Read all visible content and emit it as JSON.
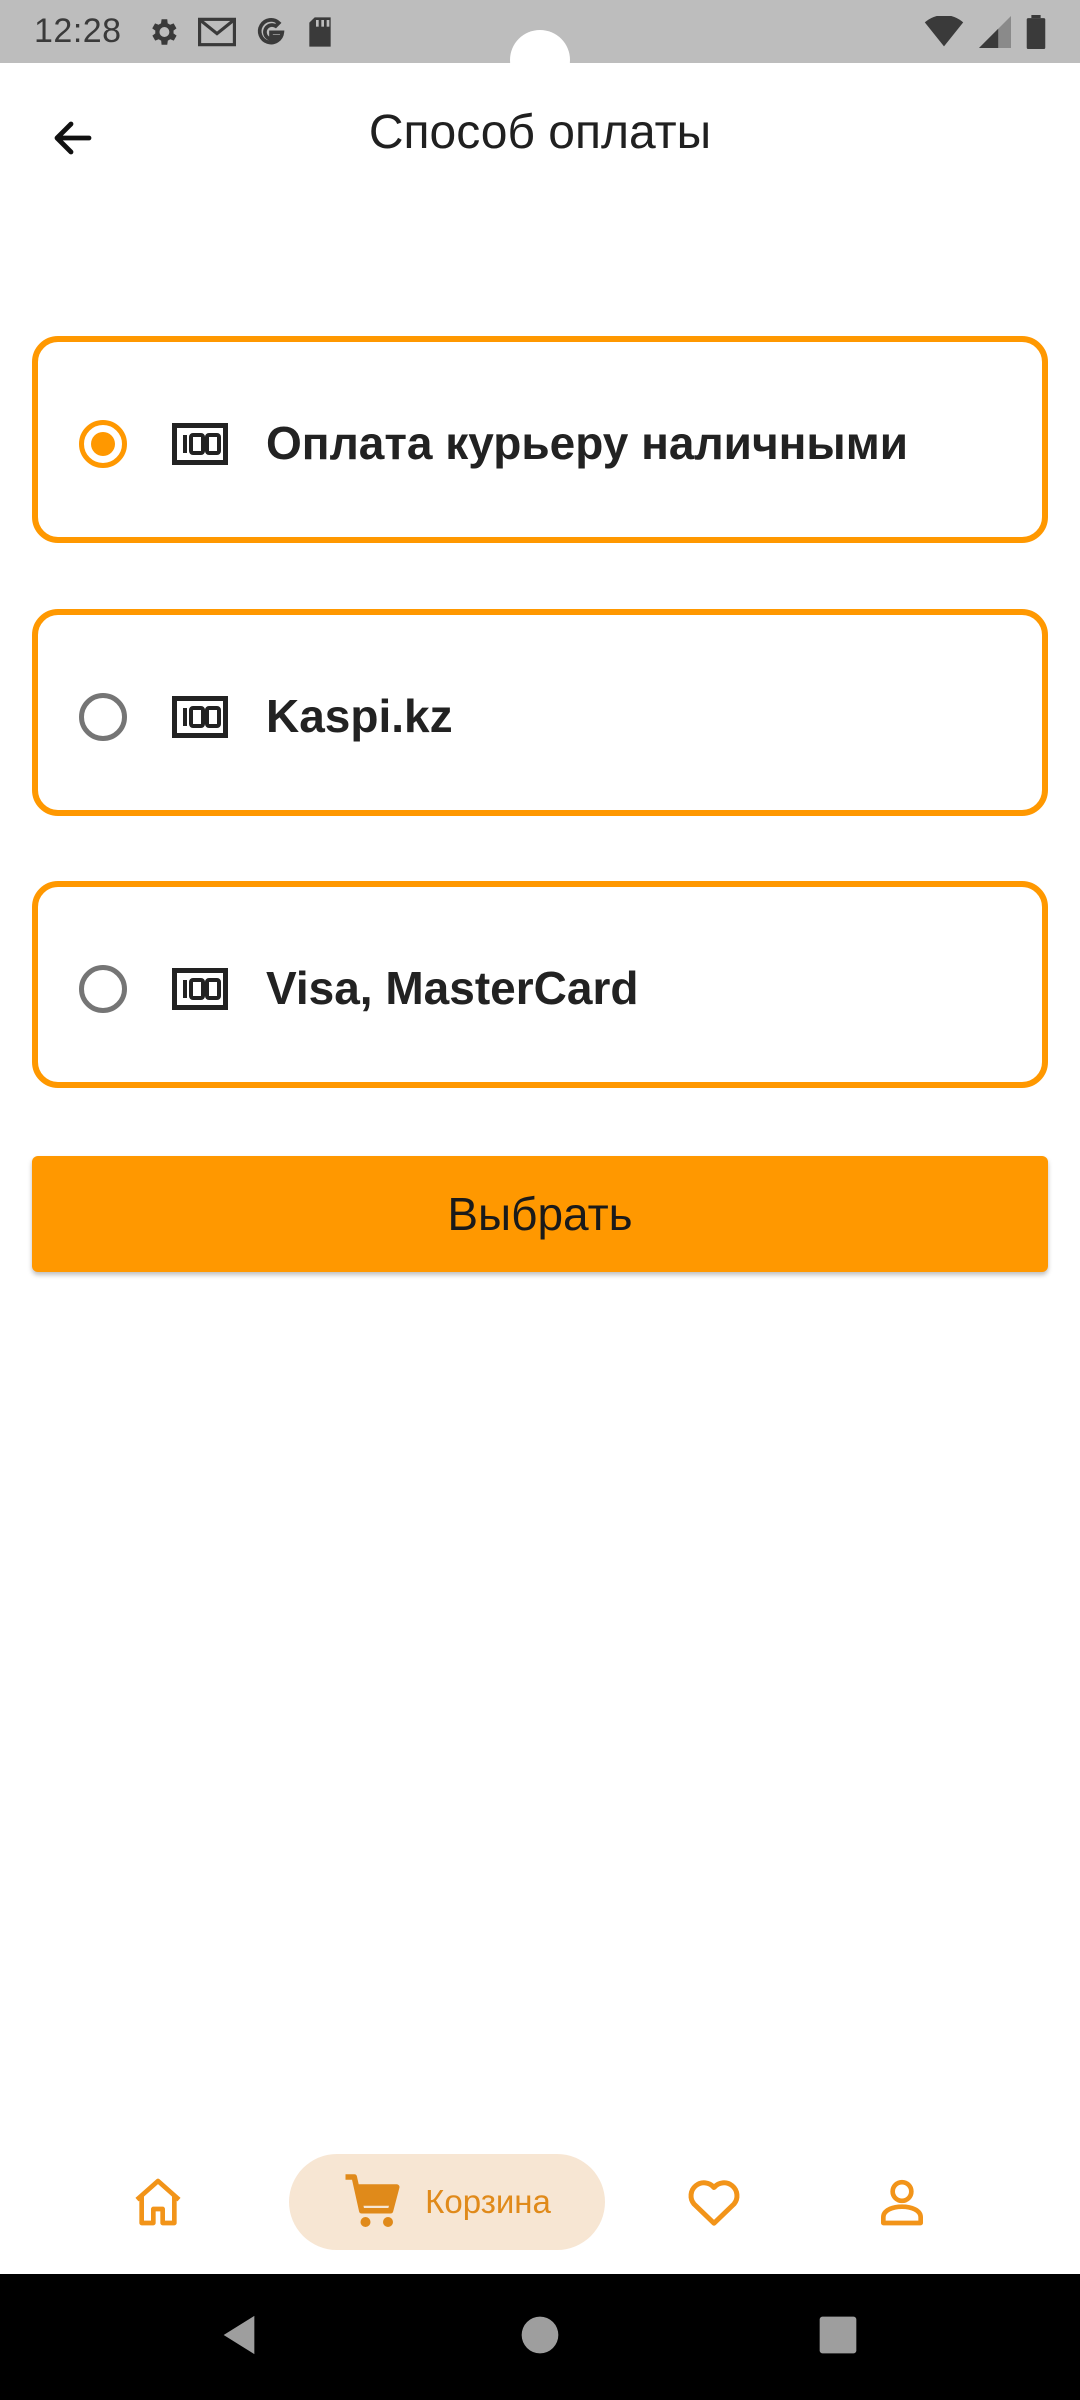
{
  "status_bar": {
    "time": "12:28",
    "icons": [
      "gear-icon",
      "gmail-icon",
      "google-icon",
      "sd-card-icon"
    ],
    "right_icons": [
      "wifi-icon",
      "signal-icon",
      "battery-icon"
    ]
  },
  "header": {
    "title": "Способ оплаты",
    "back_icon": "arrow-back-icon"
  },
  "payment_options": [
    {
      "label": "Оплата курьеру наличными",
      "selected": true,
      "icon": "cash-icon"
    },
    {
      "label": "Kaspi.kz",
      "selected": false,
      "icon": "cash-icon"
    },
    {
      "label": "Visa, MasterCard",
      "selected": false,
      "icon": "cash-icon"
    }
  ],
  "select_button": {
    "label": "Выбрать"
  },
  "bottom_nav": {
    "items": [
      {
        "icon": "home-icon"
      },
      {
        "icon": "cart-icon",
        "label": "Корзина",
        "active": true
      },
      {
        "icon": "heart-icon"
      },
      {
        "icon": "profile-icon"
      }
    ]
  },
  "colors": {
    "accent": "#ff9800",
    "active_nav_bg": "#f7e6d3",
    "status_bar": "#bdbdbd",
    "system_nav": "#000000"
  }
}
